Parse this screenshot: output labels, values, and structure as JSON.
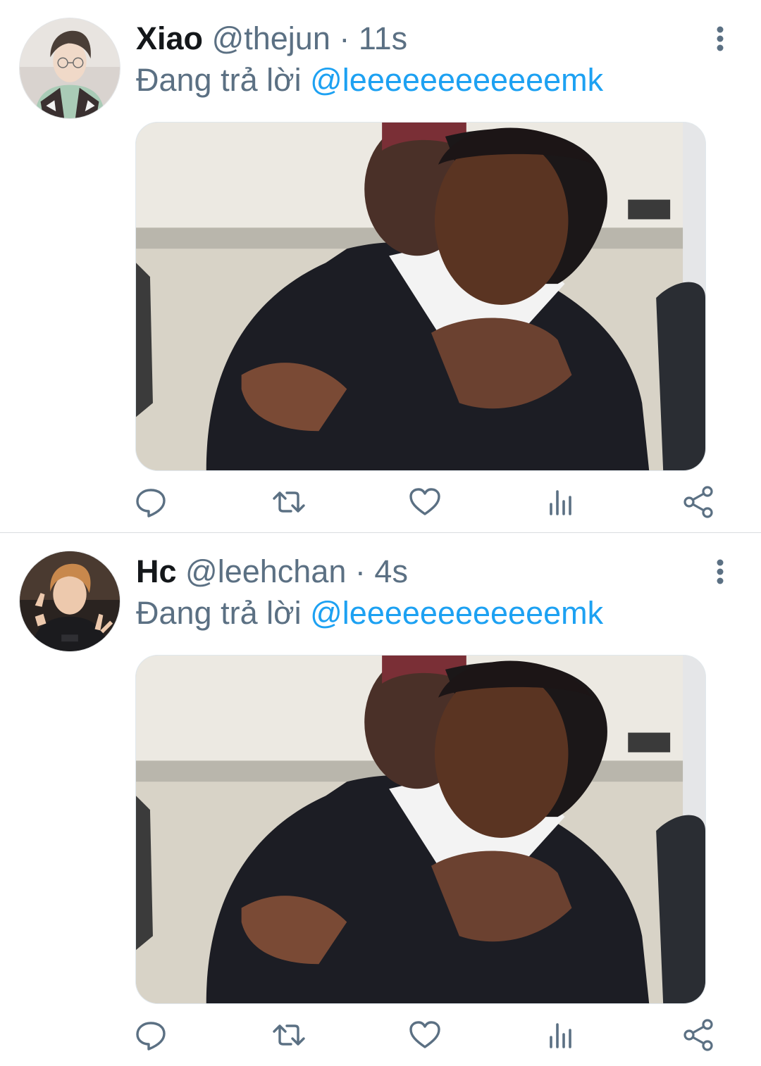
{
  "tweets": [
    {
      "name": "Xiao",
      "handle": "@thejun",
      "separator": "·",
      "time": "11s",
      "reply_prefix": "Đang trả lời",
      "reply_to": "@leeeeeeeeeeeemk",
      "avatar_description": "portrait of a young man with glasses",
      "media_description": "photo of a boy with hand on chest being hugged from behind"
    },
    {
      "name": "Hc",
      "handle": "@leehchan",
      "separator": "·",
      "time": "4s",
      "reply_prefix": "Đang trả lời",
      "reply_to": "@leeeeeeeeeeeemk",
      "avatar_description": "portrait of a young man making peace signs",
      "media_description": "photo of a boy with hand on chest being hugged from behind"
    }
  ],
  "actions": [
    "reply-icon",
    "retweet-icon",
    "like-icon",
    "analytics-icon",
    "share-icon"
  ],
  "colors": {
    "text_primary": "#14171a",
    "text_secondary": "#5b7083",
    "accent": "#1da1f2",
    "divider": "#d9dde0"
  }
}
